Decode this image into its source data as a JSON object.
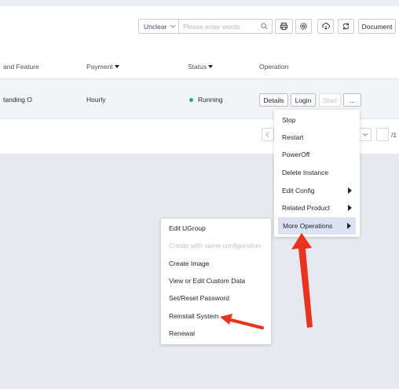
{
  "toolbar": {
    "select_value": "Unclear",
    "search_placeholder": "Please enter words",
    "document_label": "Document"
  },
  "table": {
    "columns": [
      "and Feature",
      "Payment",
      "Status",
      "Operation"
    ],
    "row": {
      "name": "tanding O",
      "payment": "Hourly",
      "status": "Running",
      "buttons": [
        "Details",
        "Login",
        "Start",
        "..."
      ]
    }
  },
  "pager": {
    "total_suffix": "/1"
  },
  "operation_menu": [
    "Stop",
    "Restart",
    "PowerOff",
    "Delete Instance",
    "Edit Config",
    "Related Product",
    "More Operations"
  ],
  "more_operations_menu": [
    "Edit UGroup",
    "Create with same configuration",
    "Create Image",
    "View or Edit Custom Data",
    "Set/Reset Password",
    "Reinstall System",
    "Renewal"
  ],
  "colors": {
    "status_running": "#20b35a",
    "annotation_arrow": "#e8331f",
    "menu_highlight": "#dde1f1"
  }
}
